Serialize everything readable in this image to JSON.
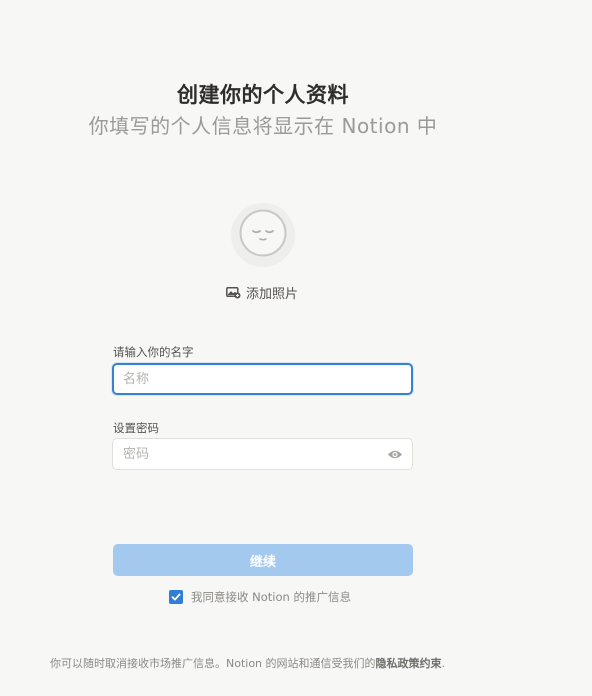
{
  "header": {
    "title": "创建你的个人资料",
    "subtitle": "你填写的个人信息将显示在 Notion 中"
  },
  "avatar": {
    "icon": "face-icon"
  },
  "photo": {
    "icon": "image-icon",
    "label": "添加照片"
  },
  "name_field": {
    "label": "请输入你的名字",
    "value": "",
    "placeholder": "名称"
  },
  "password_field": {
    "label": "设置密码",
    "value": "",
    "placeholder": "密码",
    "icon": "eye-icon"
  },
  "continue_button": {
    "label": "继续",
    "color": "#a3c9ee"
  },
  "consent": {
    "checked": true,
    "label": "我同意接收 Notion 的推广信息"
  },
  "footer": {
    "text": "你可以随时取消接收市场推广信息。Notion 的网站和通信受我们的",
    "link": "隐私政策约束",
    "end": "."
  },
  "colors": {
    "accent": "#3383d4",
    "background": "#f7f7f5"
  }
}
